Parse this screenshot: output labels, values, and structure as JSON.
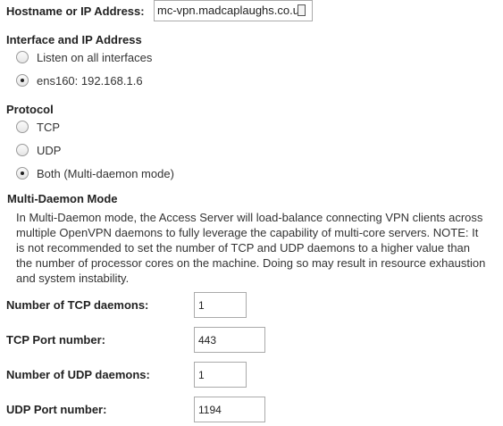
{
  "hostname": {
    "label": "Hostname or IP Address:",
    "value": "mc-vpn.madcaplaughs.co.uk"
  },
  "interface": {
    "heading": "Interface and IP Address",
    "options": [
      {
        "label": "Listen on all interfaces",
        "checked": false
      },
      {
        "label": "ens160: 192.168.1.6",
        "checked": true
      }
    ]
  },
  "protocol": {
    "heading": "Protocol",
    "options": [
      {
        "label": "TCP",
        "checked": false
      },
      {
        "label": "UDP",
        "checked": false
      },
      {
        "label": "Both (Multi-daemon mode)",
        "checked": true
      }
    ]
  },
  "multi_daemon": {
    "heading": "Multi-Daemon Mode",
    "description": "In Multi-Daemon mode, the Access Server will load-balance connecting VPN clients across multiple OpenVPN daemons to fully leverage the capability of multi-core servers. NOTE: It is not recommended to set the number of TCP and UDP daemons to a higher value than the number of processor cores on the machine. Doing so may result in resource exhaustion and system instability."
  },
  "fields": {
    "tcp_daemons": {
      "label": "Number of TCP daemons:",
      "value": "1"
    },
    "tcp_port": {
      "label": "TCP Port number:",
      "value": "443"
    },
    "udp_daemons": {
      "label": "Number of UDP daemons:",
      "value": "1"
    },
    "udp_port": {
      "label": "UDP Port number:",
      "value": "1194"
    }
  }
}
